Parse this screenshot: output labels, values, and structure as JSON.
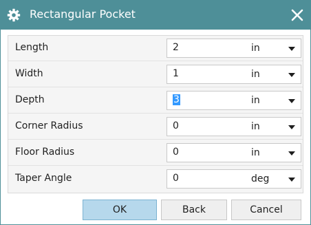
{
  "window": {
    "title": "Rectangular Pocket",
    "icon": "gear-icon",
    "close_icon": "close-icon"
  },
  "colors": {
    "titlebar": "#4e8f98",
    "ok_button": "#b6d8ec",
    "selection": "#3399ff"
  },
  "params": [
    {
      "label": "Length",
      "value": "2",
      "unit": "in"
    },
    {
      "label": "Width",
      "value": "1",
      "unit": "in"
    },
    {
      "label": "Depth",
      "value": "3",
      "unit": "in",
      "selected": true
    },
    {
      "label": "Corner Radius",
      "value": "0",
      "unit": "in"
    },
    {
      "label": "Floor Radius",
      "value": "0",
      "unit": "in"
    },
    {
      "label": "Taper Angle",
      "value": "0",
      "unit": "deg"
    }
  ],
  "buttons": {
    "ok": "OK",
    "back": "Back",
    "cancel": "Cancel"
  }
}
